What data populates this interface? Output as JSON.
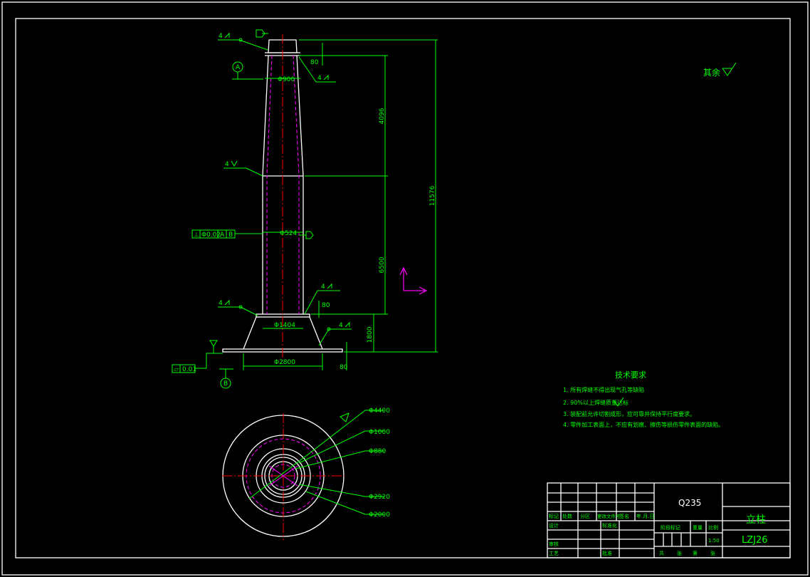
{
  "drawing": {
    "roughness_note": "其余",
    "dimensions": {
      "top_dia": "Φ900",
      "mid_dia": "Φ524",
      "base_ring_dia": "Φ1404",
      "base_plate_dia": "Φ2800",
      "upper_len": "4096",
      "lower_len": "6500",
      "total_len": "11576",
      "foot_height": "1800",
      "top_flange": "80",
      "base_flange": "80",
      "plate_thk": "80"
    },
    "datums": {
      "a": "A",
      "b": "B"
    },
    "tolerance": {
      "symbol": "⊥",
      "value": "Φ0.02",
      "ref_a": "A",
      "ref_b": "B"
    },
    "flatness": {
      "symbol": "▱",
      "value": "0.01"
    },
    "weld": {
      "size": "4"
    },
    "plan_view": {
      "d1": "Φ4400",
      "d2": "Φ1000",
      "d3": "Φ880",
      "d4": "Φ2920",
      "d5": "Φ2000"
    }
  },
  "tech_requirements": {
    "title": "技术要求",
    "items": [
      "1. 所有焊缝不得出现气孔等缺陷",
      "2. 90%以上焊缝质量达标",
      "3. 装配前允许切割成形，应可靠并保持平行度要求。",
      "4. 零件加工表面上，不应有划痕、擦伤等损伤零件表面的缺陷。"
    ]
  },
  "title_block": {
    "material": "Q235",
    "part_name": "立柱",
    "drawing_no": "LZJ26",
    "scale": "1:50",
    "labels": {
      "mark": "标记",
      "count": "处数",
      "zone": "分区",
      "change_doc": "更改文件号",
      "signature": "签名",
      "date": "年.月.日",
      "design": "设计",
      "standardize": "标准化",
      "review": "审核",
      "process": "工艺",
      "approve": "批准",
      "stage_mark": "阶段标记",
      "weight": "重量",
      "scale_label": "比例",
      "total": "共",
      "sheet": "张",
      "page": "第",
      "page2": "张"
    }
  }
}
